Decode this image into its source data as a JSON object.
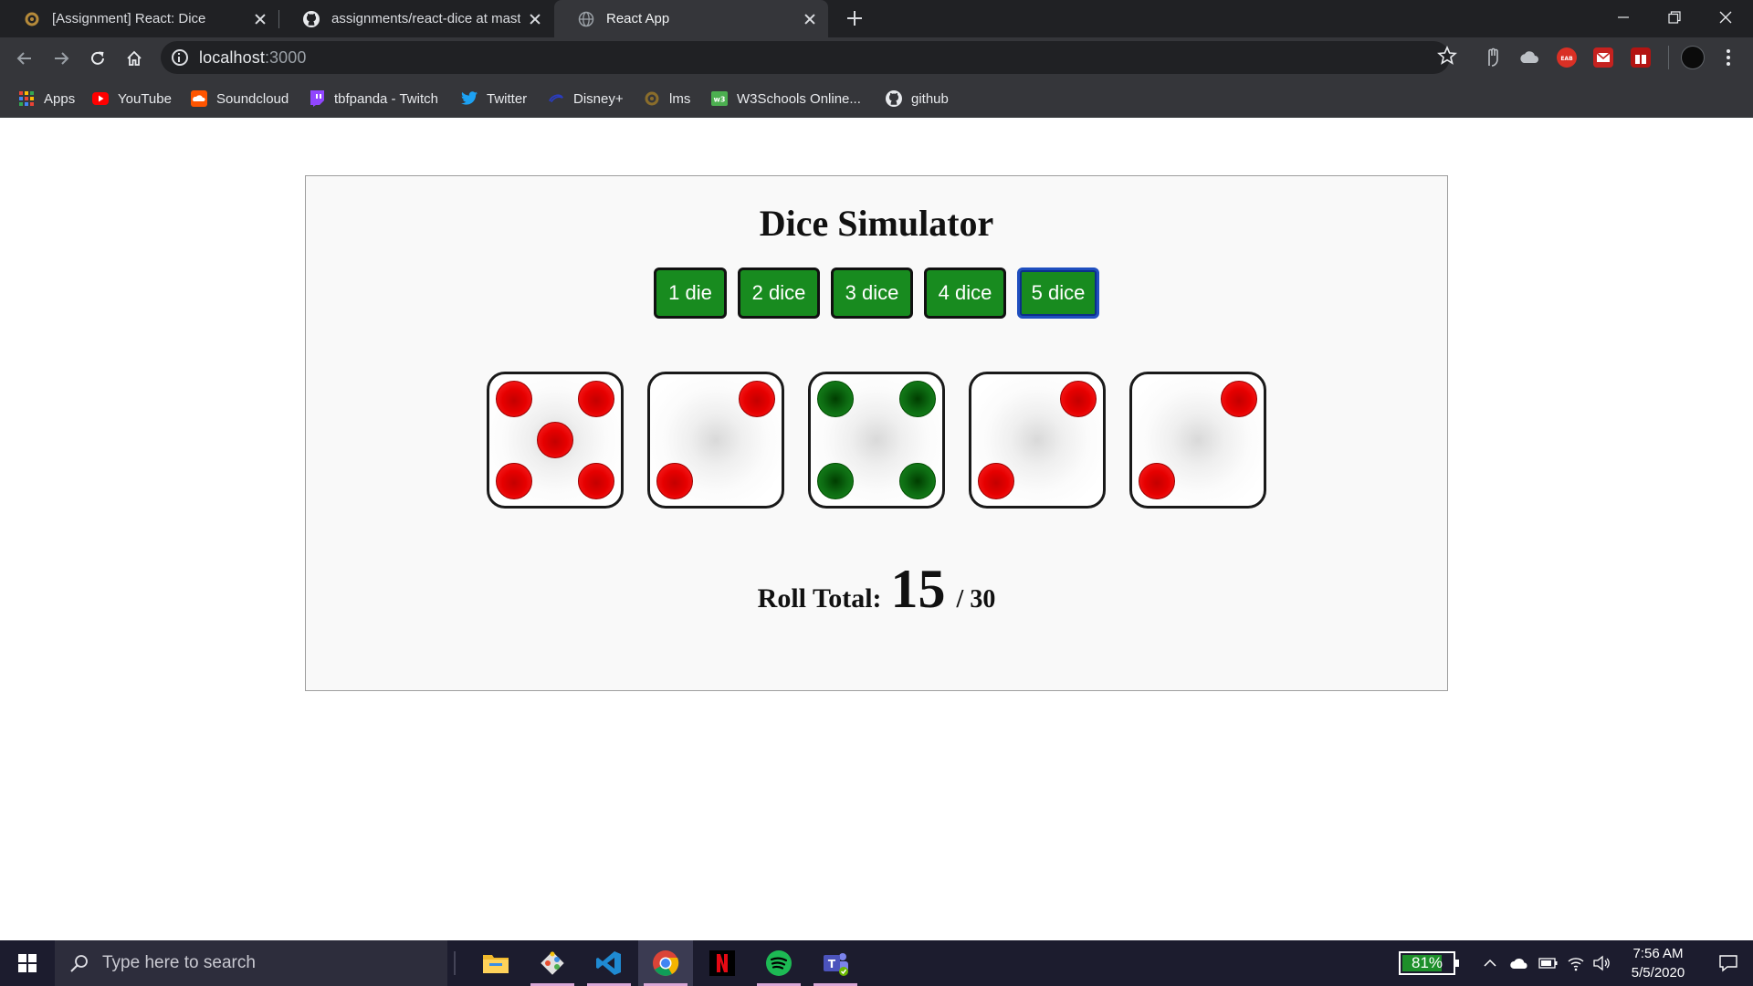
{
  "browser": {
    "tabs": [
      {
        "title": "[Assignment] React: Dice",
        "icon": "assignment-tab-icon"
      },
      {
        "title": "assignments/react-dice at master",
        "icon": "github-tab-icon"
      },
      {
        "title": "React App",
        "icon": "globe-tab-icon"
      }
    ],
    "url": {
      "host": "localhost",
      "port": ":3000"
    },
    "bookmarks": [
      {
        "label": "Apps",
        "icon": "apps-grid-icon"
      },
      {
        "label": "YouTube",
        "icon": "youtube-icon"
      },
      {
        "label": "Soundcloud",
        "icon": "soundcloud-icon"
      },
      {
        "label": "tbfpanda - Twitch",
        "icon": "twitch-icon"
      },
      {
        "label": "Twitter",
        "icon": "twitter-icon"
      },
      {
        "label": "Disney+",
        "icon": "disney-icon"
      },
      {
        "label": "lms",
        "icon": "lms-icon"
      },
      {
        "label": "W3Schools Online...",
        "icon": "w3schools-icon"
      },
      {
        "label": "github",
        "icon": "github-icon"
      }
    ]
  },
  "app": {
    "title": "Dice Simulator",
    "buttons": [
      "1 die",
      "2 dice",
      "3 dice",
      "4 dice",
      "5 dice"
    ],
    "selected_button": "5 dice",
    "dice": [
      {
        "value": 5,
        "color": "red"
      },
      {
        "value": 2,
        "color": "red"
      },
      {
        "value": 4,
        "color": "green"
      },
      {
        "value": 2,
        "color": "red"
      },
      {
        "value": 2,
        "color": "red"
      }
    ],
    "roll_total_label": "Roll Total:",
    "roll_total": "15",
    "roll_max": "/ 30",
    "colors": {
      "button_green": "#188b1f",
      "pip_red": "#e60000",
      "pip_green": "#0d6b12",
      "card_bg": "#f9f9f9"
    }
  },
  "taskbar": {
    "search_placeholder": "Type here to search",
    "apps": [
      "file-explorer-icon",
      "git-icon",
      "vscode-icon",
      "chrome-icon",
      "netflix-icon",
      "spotify-icon",
      "teams-icon"
    ],
    "battery": "81%",
    "battery_level": 0.81,
    "time": "7:56 AM",
    "date": "5/5/2020"
  }
}
